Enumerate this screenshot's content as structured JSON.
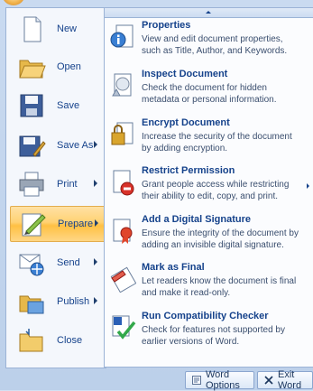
{
  "commands": [
    {
      "id": "new",
      "label": "New",
      "icon": "new-document-icon",
      "has_submenu": false
    },
    {
      "id": "open",
      "label": "Open",
      "icon": "open-folder-icon",
      "has_submenu": false
    },
    {
      "id": "save",
      "label": "Save",
      "icon": "save-disk-icon",
      "has_submenu": false
    },
    {
      "id": "save-as",
      "label": "Save As",
      "icon": "save-as-icon",
      "has_submenu": true
    },
    {
      "id": "print",
      "label": "Print",
      "icon": "printer-icon",
      "has_submenu": true
    },
    {
      "id": "prepare",
      "label": "Prepare",
      "icon": "prepare-icon",
      "has_submenu": true,
      "active": true
    },
    {
      "id": "send",
      "label": "Send",
      "icon": "send-icon",
      "has_submenu": true
    },
    {
      "id": "publish",
      "label": "Publish",
      "icon": "publish-icon",
      "has_submenu": true
    },
    {
      "id": "close",
      "label": "Close",
      "icon": "close-folder-icon",
      "has_submenu": false
    }
  ],
  "submenu": {
    "items": [
      {
        "title": "Properties",
        "desc": "View and edit document properties, such as Title, Author, and Keywords.",
        "icon": "properties-icon"
      },
      {
        "title": "Inspect Document",
        "desc": "Check the document for hidden metadata or personal information.",
        "icon": "inspect-document-icon"
      },
      {
        "title": "Encrypt Document",
        "desc": "Increase the security of the document by adding encryption.",
        "icon": "encrypt-lock-icon"
      },
      {
        "title": "Restrict Permission",
        "desc": "Grant people access while restricting their ability to edit, copy, and print.",
        "icon": "restrict-permission-icon",
        "has_submenu": true
      },
      {
        "title": "Add a Digital Signature",
        "desc": "Ensure the integrity of the document by adding an invisible digital signature.",
        "icon": "digital-signature-icon"
      },
      {
        "title": "Mark as Final",
        "desc": "Let readers know the document is final and make it read-only.",
        "icon": "mark-final-icon"
      },
      {
        "title": "Run Compatibility Checker",
        "desc": "Check for features not supported by earlier versions of Word.",
        "icon": "compatibility-checker-icon"
      }
    ]
  },
  "bottom": {
    "options_label": "Word Options",
    "exit_label": "Exit Word"
  }
}
